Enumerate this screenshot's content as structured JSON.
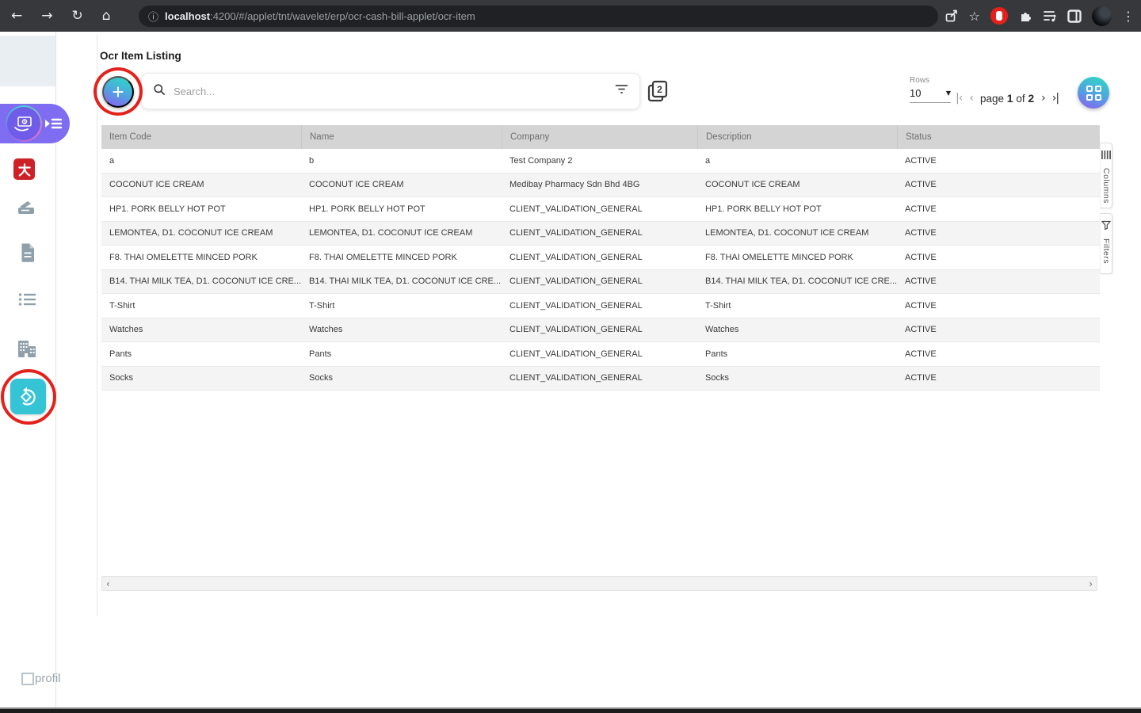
{
  "browser": {
    "url_host": "localhost",
    "url_rest": ":4200/#/applet/tnt/wavelet/erp/ocr-cash-bill-applet/ocr-item"
  },
  "icons": {
    "back": "←",
    "forward": "→",
    "reload": "↻",
    "home": "⌂",
    "info": "ⓘ",
    "star": "☆",
    "kebab": "⋮",
    "dropdown": "▼",
    "scroll_left": "‹",
    "scroll_right": "›"
  },
  "listing": {
    "title": "Ocr Item Listing",
    "search_placeholder": "Search...",
    "pages_badge": "2"
  },
  "pagination": {
    "rows_label": "Rows",
    "rows_per_page": "10",
    "first_glyph": "|‹",
    "prev_glyph": "‹",
    "page_word": "page",
    "current_page": "1",
    "of_word": "of",
    "total_pages": "2",
    "next_glyph": "›",
    "last_glyph": "›|"
  },
  "side_tabs": {
    "columns_label": "Columns",
    "filters_label": "Filters"
  },
  "sidebar": {
    "profile_label": "profil"
  },
  "colors": {
    "accent_teal": "#2ed8c6",
    "accent_purple": "#8d5bf3",
    "annotation_red": "#e4211b",
    "sidebar_purple_pill": "#7e6cf1",
    "sidebar_teal_button": "#35c3d6",
    "red_applet": "#ce2127",
    "table_header_bg": "#d4d4d4"
  },
  "table": {
    "columns": [
      "Item Code",
      "Name",
      "Company",
      "Description",
      "Status"
    ],
    "row_keys": [
      "item_code",
      "name",
      "company",
      "description",
      "status"
    ],
    "rows": [
      {
        "item_code": "a",
        "name": "b",
        "company": "Test Company 2",
        "description": "a",
        "status": "ACTIVE"
      },
      {
        "item_code": "COCONUT ICE CREAM",
        "name": "COCONUT ICE CREAM",
        "company": "Medibay Pharmacy Sdn Bhd 4BG",
        "description": "COCONUT ICE CREAM",
        "status": "ACTIVE"
      },
      {
        "item_code": "HP1. PORK BELLY HOT POT",
        "name": "HP1. PORK BELLY HOT POT",
        "company": "CLIENT_VALIDATION_GENERAL",
        "description": "HP1. PORK BELLY HOT POT",
        "status": "ACTIVE"
      },
      {
        "item_code": "LEMONTEA, D1. COCONUT ICE CREAM",
        "name": "LEMONTEA, D1. COCONUT ICE CREAM",
        "company": "CLIENT_VALIDATION_GENERAL",
        "description": "LEMONTEA, D1. COCONUT ICE CREAM",
        "status": "ACTIVE"
      },
      {
        "item_code": "F8. THAI OMELETTE MINCED PORK",
        "name": "F8. THAI OMELETTE MINCED PORK",
        "company": "CLIENT_VALIDATION_GENERAL",
        "description": "F8. THAI OMELETTE MINCED PORK",
        "status": "ACTIVE"
      },
      {
        "item_code": "B14. THAI MILK TEA, D1. COCONUT ICE CRE...",
        "name": "B14. THAI MILK TEA, D1. COCONUT ICE CRE...",
        "company": "CLIENT_VALIDATION_GENERAL",
        "description": "B14. THAI MILK TEA, D1. COCONUT ICE CRE...",
        "status": "ACTIVE"
      },
      {
        "item_code": "T-Shirt",
        "name": "T-Shirt",
        "company": "CLIENT_VALIDATION_GENERAL",
        "description": "T-Shirt",
        "status": "ACTIVE"
      },
      {
        "item_code": "Watches",
        "name": "Watches",
        "company": "CLIENT_VALIDATION_GENERAL",
        "description": "Watches",
        "status": "ACTIVE"
      },
      {
        "item_code": "Pants",
        "name": "Pants",
        "company": "CLIENT_VALIDATION_GENERAL",
        "description": "Pants",
        "status": "ACTIVE"
      },
      {
        "item_code": "Socks",
        "name": "Socks",
        "company": "CLIENT_VALIDATION_GENERAL",
        "description": "Socks",
        "status": "ACTIVE"
      }
    ]
  }
}
